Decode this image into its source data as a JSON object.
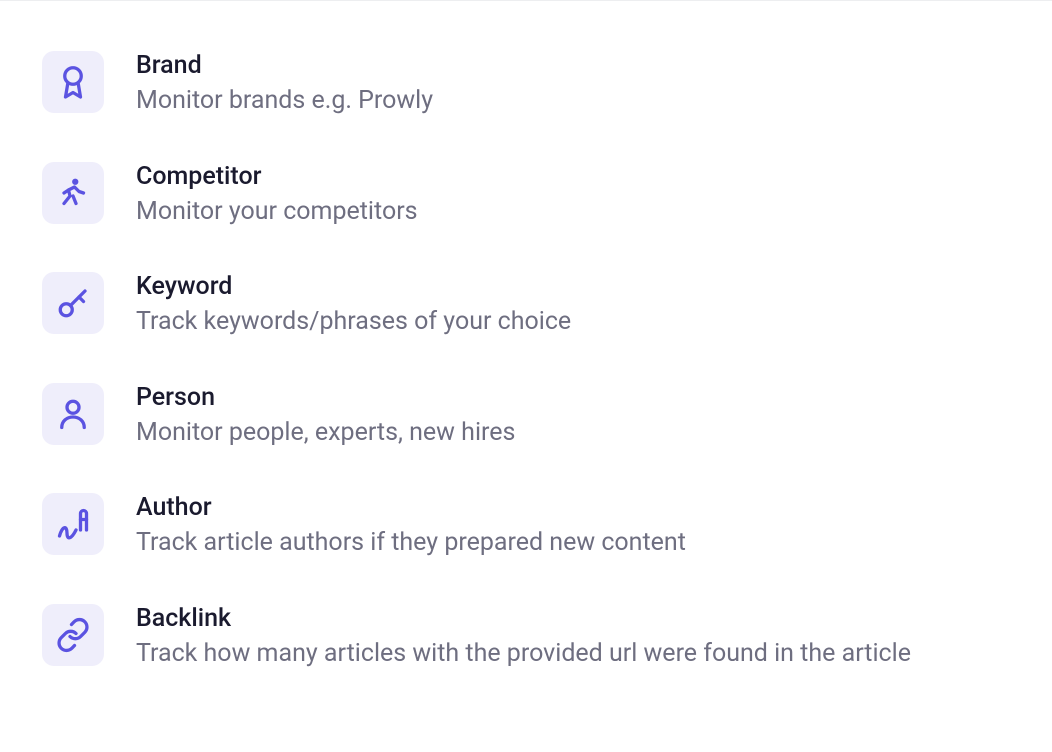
{
  "options": [
    {
      "title": "Brand",
      "desc": "Monitor brands e.g. Prowly"
    },
    {
      "title": "Competitor",
      "desc": "Monitor your competitors"
    },
    {
      "title": "Keyword",
      "desc": "Track keywords/phrases of your choice"
    },
    {
      "title": "Person",
      "desc": "Monitor people, experts, new hires"
    },
    {
      "title": "Author",
      "desc": "Track article authors if they prepared new content"
    },
    {
      "title": "Backlink",
      "desc": "Track how many articles with the provided url were found in the article"
    }
  ]
}
